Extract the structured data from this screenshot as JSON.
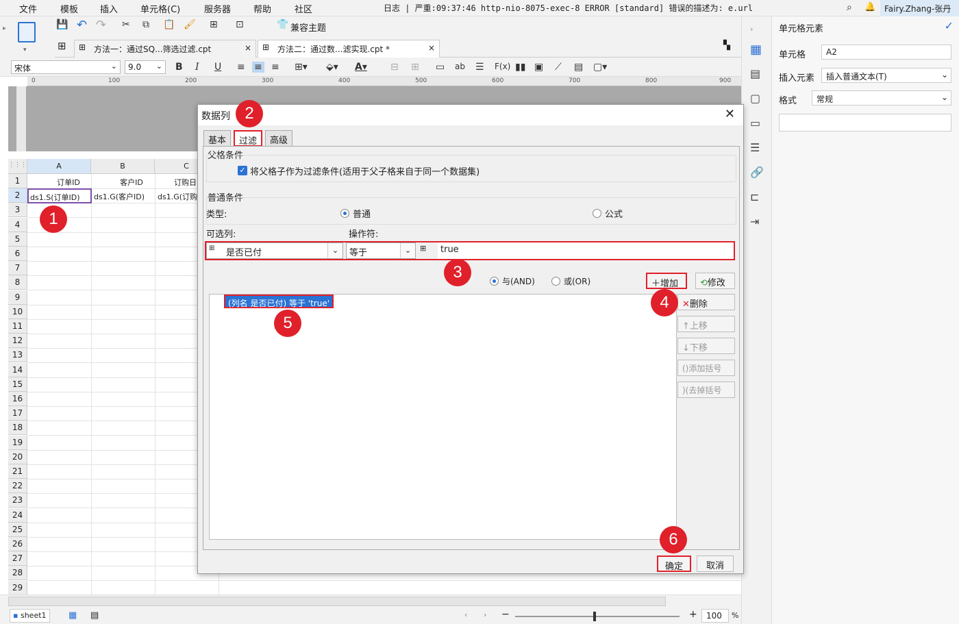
{
  "menu": [
    "文件",
    "模板",
    "插入",
    "单元格(C)",
    "服务器",
    "帮助",
    "社区"
  ],
  "log_text": "日志 | 严重:09:37:46 http-nio-8075-exec-8 ERROR [standard] 错误的描述为: e.url",
  "user": "Fairy.Zhang-张丹",
  "toolbar": {
    "compat_theme": "兼容主题"
  },
  "file_tabs": [
    {
      "label": "方法一：通过SQ...筛选过滤.cpt",
      "close": "×"
    },
    {
      "label": "方法二：通过数...滤实现.cpt *",
      "close": "×"
    }
  ],
  "font": {
    "name": "宋体",
    "size": "9.0"
  },
  "ruler_marks": [
    "0",
    "100",
    "200",
    "300",
    "400",
    "500",
    "600",
    "700",
    "800",
    "900"
  ],
  "grid": {
    "columns": [
      "A",
      "B",
      "C"
    ],
    "rows": [
      "1",
      "2",
      "3",
      "4",
      "5",
      "6",
      "7",
      "8",
      "9",
      "10",
      "11",
      "12",
      "13",
      "14",
      "15",
      "16",
      "17",
      "18",
      "19",
      "20",
      "21",
      "22",
      "23",
      "24",
      "25",
      "26",
      "27",
      "28",
      "29"
    ],
    "header_cells": [
      "订单ID",
      "客户ID",
      "订购日"
    ],
    "data_cells": [
      "ds1.S(订单ID)",
      "ds1.G(客户ID)",
      "ds1.G(订购"
    ]
  },
  "sheet_tab": "sheet1",
  "zoom": "100",
  "zoom_unit": "%",
  "right_panel": {
    "title": "单元格元素",
    "cell_label": "单元格",
    "cell_value": "A2",
    "insert_label": "插入元素",
    "insert_value": "插入普通文本(T)",
    "format_label": "格式",
    "format_value": "常规"
  },
  "dialog": {
    "title": "数据列",
    "tabs": [
      "基本",
      "过滤",
      "高级"
    ],
    "parent_group": "父格条件",
    "parent_checkbox": "将父格子作为过滤条件(适用于父子格来自于同一个数据集)",
    "normal_group": "普通条件",
    "type_label": "类型:",
    "type_normal": "普通",
    "type_formula": "公式",
    "column_label": "可选列:",
    "operator_label": "操作符:",
    "column_value": "是否已付",
    "operator_value": "等于",
    "value": "true",
    "and_label": "与(AND)",
    "or_label": "或(OR)",
    "add": "增加",
    "modify": "修改",
    "delete": "删除",
    "up": "上移",
    "down": "下移",
    "add_bracket": "添加括号",
    "remove_bracket": "去掉括号",
    "condition": "(列名 是否已付) 等于 'true'",
    "ok": "确定",
    "cancel": "取消"
  },
  "markers": [
    "1",
    "2",
    "3",
    "4",
    "5",
    "6"
  ],
  "colors": {
    "accent": "#2a72d4",
    "highlight": "#e0202a"
  }
}
